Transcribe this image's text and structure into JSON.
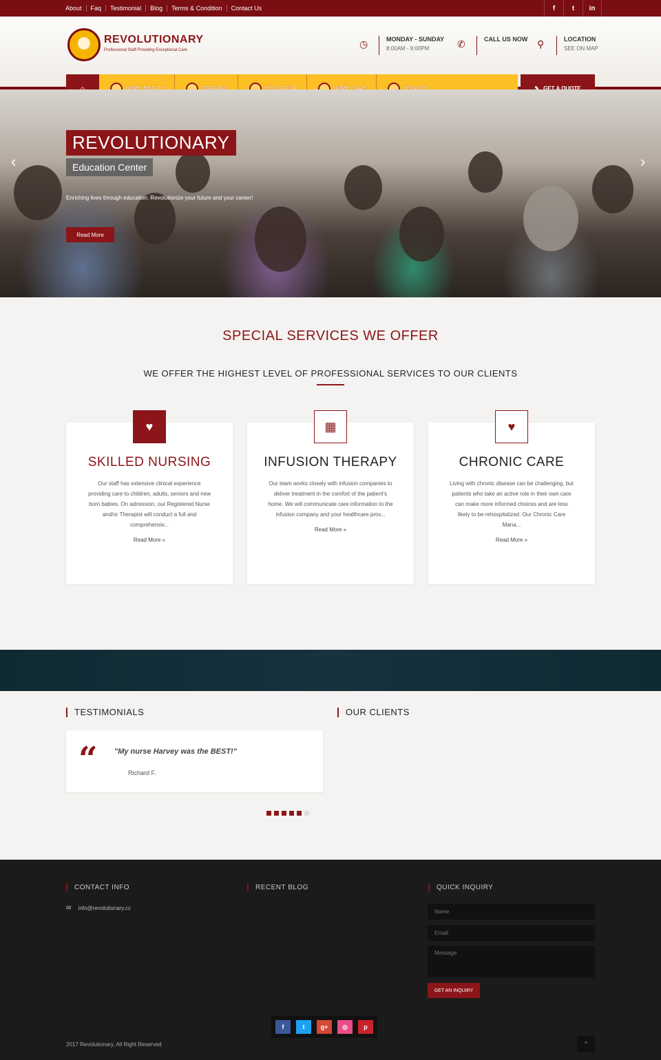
{
  "topbar": {
    "links": [
      "About",
      "Faq",
      "Testimonial",
      "Blog",
      "Terms & Condition",
      "Contact Us"
    ],
    "socials": [
      "f",
      "t",
      "in"
    ]
  },
  "header": {
    "brand": "REVOLUTIONARY",
    "tagline": "Professional Staff Providing Exceptional Care",
    "hours_title": "MONDAY - SUNDAY",
    "hours_value": "8:00AM - 9:00PM",
    "call_title": "CALL US NOW",
    "location_title": "LOCATION",
    "location_value": "SEE ON MAP"
  },
  "nav": {
    "items": [
      "HOME HEALTH",
      "STAFFING",
      "EDUCATION",
      "HOME CARE",
      "HOSPICE"
    ],
    "quote": "GET A QUOTE"
  },
  "hero": {
    "title": "REVOLUTIONARY",
    "subtitle": "Education Center",
    "text": "Enriching lives through education.  Revolutionize your future and your career!",
    "button": "Read More"
  },
  "services": {
    "title": "SPECIAL SERVICES WE OFFER",
    "subtitle": "WE OFFER THE HIGHEST LEVEL OF PROFESSIONAL SERVICES TO OUR CLIENTS",
    "cards": [
      {
        "title": "SKILLED NURSING",
        "text": "Our staff has extensive clinical experience providing care to children, adults, seniors and new born babies. On admission, our Registered Nurse and/or Therapist will conduct a full and comprehensiv...",
        "more": "Read More  »"
      },
      {
        "title": "INFUSION THERAPY",
        "text": "Our team works closely with infusion companies to deliver treatment in the comfort of the patient's home. We will communicate care information to the infusion company and your healthcare prov...",
        "more": "Read More  »"
      },
      {
        "title": "CHRONIC CARE",
        "text": "Living with chronic disease can be challenging, but patients who take an active role in their own care can make more informed choices and are less likely to be rehospitalized. Our Chronic Care Mana...",
        "more": "Read More  »"
      }
    ]
  },
  "testimonials": {
    "heading": "TESTIMONIALS",
    "quote": "\"My nurse Harvey was the BEST!\"",
    "author": "Richard F.",
    "slides_total": 6,
    "slides_active": 5
  },
  "clients": {
    "heading": "OUR CLIENTS"
  },
  "footer": {
    "contact_heading": "CONTACT INFO",
    "email": "info@revolutionary.cc",
    "blog_heading": "RECENT BLOG",
    "inquiry_heading": "QUICK INQUIRY",
    "name_placeholder": "Name",
    "email_placeholder": "Email",
    "message_placeholder": "Message",
    "submit": "GET AN INQUIRY",
    "copyright": "2017 Revolutionary, All Right Reserved",
    "socials": [
      "f",
      "t",
      "g+",
      "◎",
      "p"
    ]
  },
  "colors": {
    "brand": "#8b1518",
    "accent": "#fcbf24",
    "footer": "#1b1b1b"
  }
}
